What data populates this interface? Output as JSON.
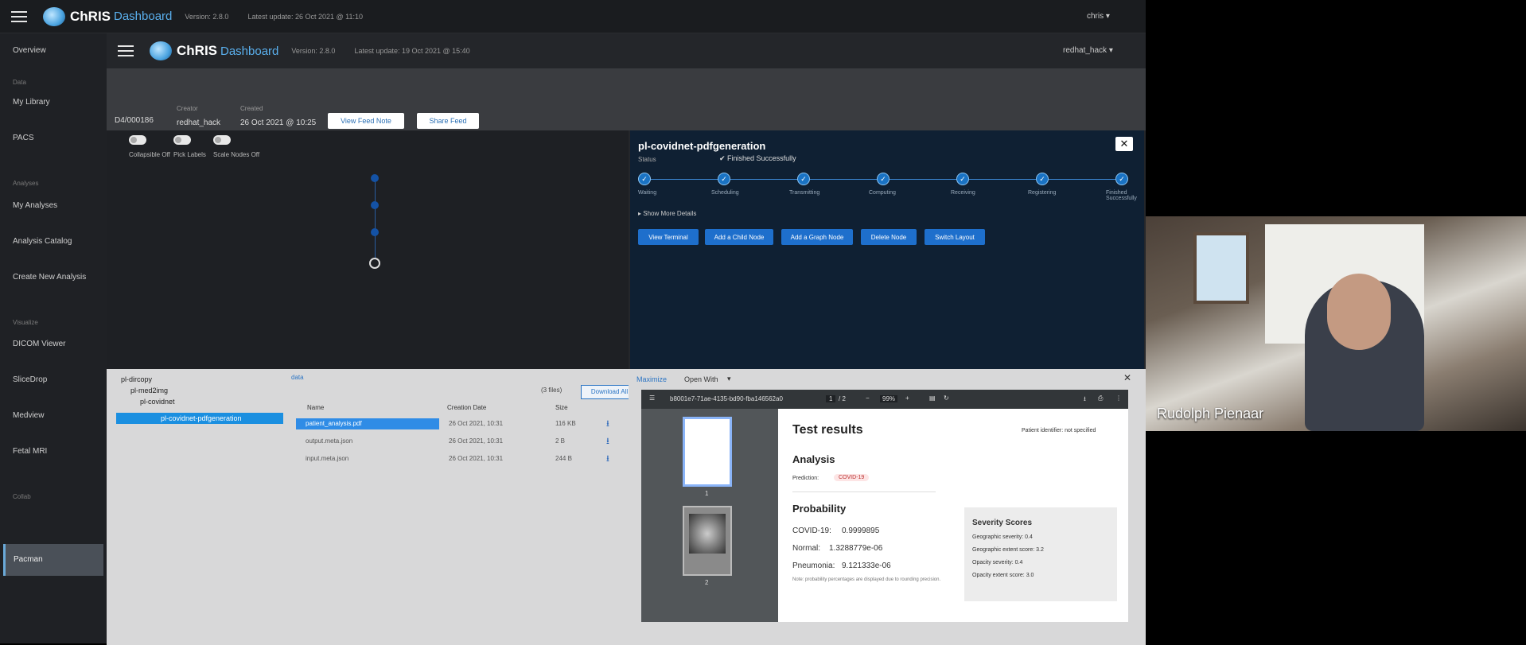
{
  "outer": {
    "brand": "ChRIS",
    "brand_sub": "Dashboard",
    "version": "Version: 2.8.0",
    "updated": "Latest update: 26 Oct 2021 @ 11:10",
    "user": "chris",
    "sidebar": {
      "overview": "Overview",
      "section_data": "Data",
      "my_library": "My Library",
      "pacs": "PACS",
      "section_analyses": "Analyses",
      "my_analyses": "My Analyses",
      "analysis_catalog": "Analysis Catalog",
      "create_new_analysis": "Create New Analysis",
      "section_visualize": "Visualize",
      "dicom_viewer": "DICOM Viewer",
      "slicedrop": "SliceDrop",
      "medview": "Medview",
      "fetal_mri": "Fetal MRI",
      "section_collab": "Collab",
      "active": "Pacman"
    }
  },
  "inner": {
    "brand": "ChRIS",
    "brand_sub": "Dashboard",
    "version": "Version: 2.8.0",
    "updated": "Latest update: 19 Oct 2021 @ 15:40",
    "user": "redhat_hack",
    "feed": {
      "id": "D4/000186",
      "creator_label": "Creator",
      "creator": "redhat_hack",
      "created_label": "Created",
      "created": "26 Oct 2021 @ 10:25",
      "view_note": "View Feed Note",
      "share": "Share Feed"
    },
    "graph": {
      "toggles": [
        "Collapsible Off",
        "Pick Labels",
        "Scale Nodes Off"
      ]
    },
    "details": {
      "title": "pl-covidnet-pdfgeneration",
      "status_label": "Status",
      "status_value": "✔ Finished Successfully",
      "steps": [
        "Waiting",
        "Scheduling",
        "Transmitting",
        "Computing",
        "Receiving",
        "Registering",
        "Finished Successfully"
      ],
      "show_more": "▸  Show More Details",
      "buttons": [
        "View Terminal",
        "Add a Child Node",
        "Add a Graph Node",
        "Delete Node",
        "Switch Layout"
      ]
    },
    "files": {
      "tree": [
        "pl-dircopy",
        "pl-med2img",
        "pl-covidnet",
        "pl-covidnet-pdfgeneration"
      ],
      "breadcrumb": "data",
      "count": "(3 files)",
      "download_all": "Download All",
      "headers": [
        "Name",
        "Creation Date",
        "Size"
      ],
      "rows": [
        {
          "name": "patient_analysis.pdf",
          "date": "26 Oct 2021, 10:31",
          "size": "116 KB"
        },
        {
          "name": "output.meta.json",
          "date": "26 Oct 2021, 10:31",
          "size": "2 B"
        },
        {
          "name": "input.meta.json",
          "date": "26 Oct 2021, 10:31",
          "size": "244 B"
        }
      ]
    },
    "viewer": {
      "tab_maximize": "Maximize",
      "tab_open_with": "Open With",
      "pdf_file": "b8001e7-71ae-4135-bd90-fba146562a0",
      "page_num": "1",
      "page_total": "/ 2",
      "zoom": "99%",
      "title": "Test results",
      "patient": "Patient identifier: not specified",
      "analysis": "Analysis",
      "prediction_label": "Prediction:",
      "prediction_value": "COVID-19",
      "probability": "Probability",
      "covid": "COVID-19:",
      "covid_val": "0.9999895",
      "normal": "Normal:",
      "normal_val": "1.3288779e-06",
      "pneumonia": "Pneumonia:",
      "pneumonia_val": "9.121333e-06",
      "note": "Note: probability percentages are displayed due to rounding precision.",
      "severity_title": "Severity Scores",
      "sev": [
        "Geographic severity: 0.4",
        "Geographic extent score: 3.2",
        "Opacity severity: 0.4",
        "Opacity extent score: 3.0"
      ],
      "thumb_labels": [
        "1",
        "2"
      ]
    }
  },
  "cam": {
    "name": "Rudolph Pienaar"
  }
}
